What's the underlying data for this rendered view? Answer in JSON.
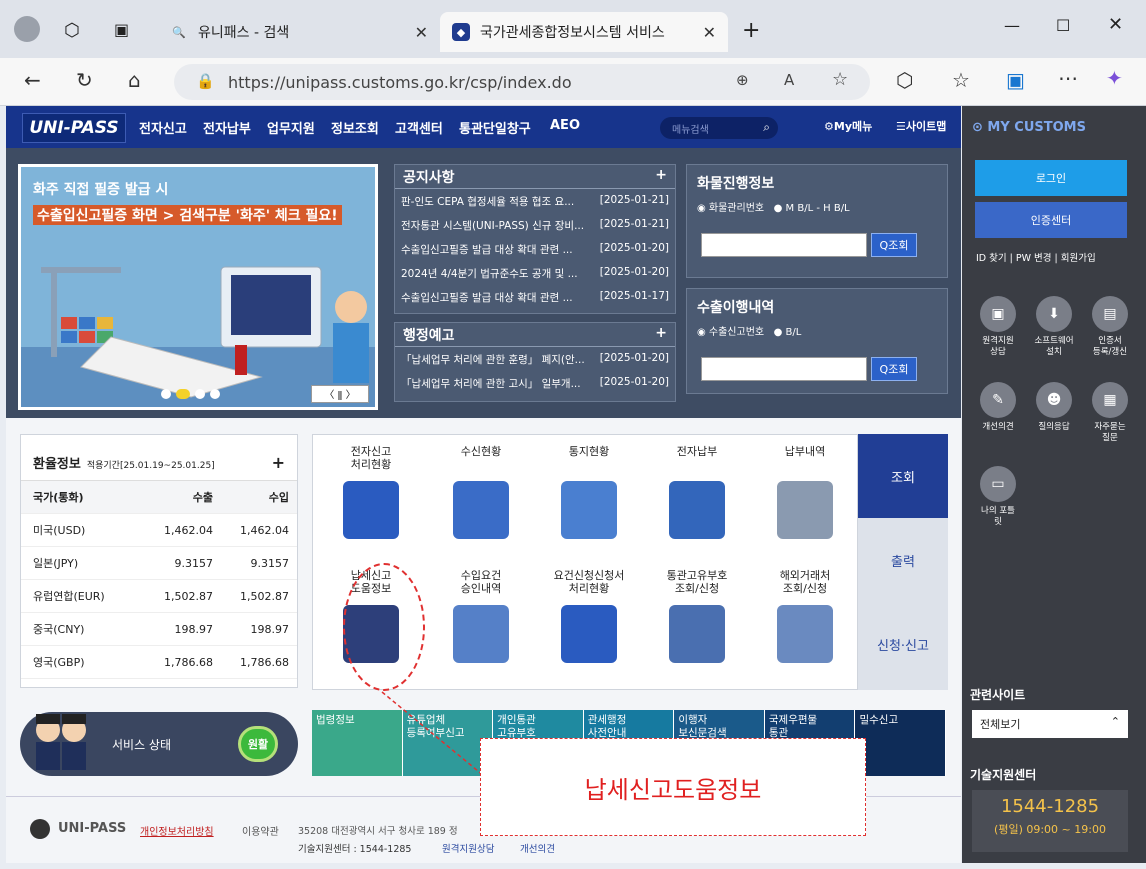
{
  "browser": {
    "tab_inactive": "유니패스 - 검색",
    "tab_active": "국가관세종합정보시스템 서비스",
    "url": "https://unipass.customs.go.kr/csp/index.do"
  },
  "gnb": {
    "logo": "UNI-PASS",
    "menus": [
      "전자신고",
      "전자납부",
      "업무지원",
      "정보조회",
      "고객센터",
      "통관단일창구",
      "AEO"
    ],
    "search_placeholder": "메뉴검색",
    "my_menu": "My메뉴",
    "sitemap": "사이트맵"
  },
  "banner": {
    "line1": "화주 직접 필증 발급 시",
    "line2": "수출입신고필증 화면 > 검색구분 '화주' 체크 필요!",
    "pager": "〈 ǁ 〉"
  },
  "notice": {
    "title": "공지사항",
    "plus": "+",
    "items": [
      {
        "t": "판-인도 CEPA 협정세율 적용 협조 요...",
        "d": "[2025-01-21]"
      },
      {
        "t": "전자통관 시스템(UNI-PASS) 신규 장비...",
        "d": "[2025-01-21]"
      },
      {
        "t": "수출입신고필증 발급 대상 확대 관련 ...",
        "d": "[2025-01-20]"
      },
      {
        "t": "2024년 4/4분기 법규준수도 공개 및 ...",
        "d": "[2025-01-20]"
      },
      {
        "t": "수출입신고필증 발급 대상 확대 관련 ...",
        "d": "[2025-01-17]"
      }
    ]
  },
  "admin": {
    "title": "행정예고",
    "plus": "+",
    "items": [
      {
        "t": "「납세업무 처리에 관한 훈령」 폐지(안...",
        "d": "[2025-01-20]"
      },
      {
        "t": "「납세업무 처리에 관한 고시」 일부개...",
        "d": "[2025-01-20]"
      }
    ]
  },
  "cargo": {
    "title": "화물진행정보",
    "radio1": "◉ 화물관리번호",
    "radio2": "● M B/L - H B/L",
    "btn": "Q조회"
  },
  "export": {
    "title": "수출이행내역",
    "radio1": "◉ 수출신고번호",
    "radio2": "● B/L",
    "btn": "Q조회"
  },
  "exchange": {
    "title": "환율정보",
    "period": "적용기간[25.01.19~25.01.25]",
    "plus": "+",
    "headers": [
      "국가(통화)",
      "수출",
      "수입"
    ],
    "rows": [
      [
        "미국(USD)",
        "1,462.04",
        "1,462.04"
      ],
      [
        "일본(JPY)",
        "9.3157",
        "9.3157"
      ],
      [
        "유럽연합(EUR)",
        "1,502.87",
        "1,502.87"
      ],
      [
        "중국(CNY)",
        "198.97",
        "198.97"
      ],
      [
        "영국(GBP)",
        "1,786.68",
        "1,786.68"
      ]
    ]
  },
  "services": [
    {
      "label": "전자신고\n처리현황",
      "color": "#2a5bc0"
    },
    {
      "label": "수신현황",
      "color": "#3a6cc7"
    },
    {
      "label": "통지현황",
      "color": "#4a7fd0"
    },
    {
      "label": "전자납부",
      "color": "#3366bb"
    },
    {
      "label": "납부내역",
      "color": "#8a9ab0"
    },
    {
      "label": "납세신고\n도움정보",
      "color": "#2d3f7a"
    },
    {
      "label": "수입요건\n승인내역",
      "color": "#5580c8"
    },
    {
      "label": "요건신청신청서\n처리현황",
      "color": "#2a5bc0"
    },
    {
      "label": "통관고유부호\n조회/신청",
      "color": "#4a6fb0"
    },
    {
      "label": "해외거래처\n조회/신청",
      "color": "#6a8ac0"
    }
  ],
  "service_tabs": [
    "조회",
    "출력",
    "신청·신고"
  ],
  "status": {
    "label": "서비스 상태",
    "badge": "원활"
  },
  "quick": [
    {
      "label": "법령정보",
      "color": "#3aa88a"
    },
    {
      "label": "유튜업체\n등록여부신고",
      "color": "#2f9a9a"
    },
    {
      "label": "개인통관\n고유부호",
      "color": "#1f8aa0"
    },
    {
      "label": "관세행정\n사전안내",
      "color": "#167aa0"
    },
    {
      "label": "이행자\n보신문검색",
      "color": "#1a5a8a"
    },
    {
      "label": "국제우편물\n통관",
      "color": "#123e70"
    },
    {
      "label": "밀수신고",
      "color": "#0e2c58"
    }
  ],
  "footer": {
    "logo": "UNI-PASS",
    "privacy": "개인정보처리방침",
    "terms": "이용약관",
    "address": "35208 대전광역시 서구 청사로 189 정",
    "support": "기술지원센터 : 1544-1285",
    "remote": "원격지원상담",
    "feedback": "개선의견"
  },
  "callout": "납세신고도움정보",
  "right": {
    "title": "MY CUSTOMS",
    "login": "로그인",
    "cert": "인증센터",
    "links": "ID 찾기 | PW 변경 | 회원가입",
    "icons": [
      {
        "label": "원격지원\n상담",
        "icon": "▣"
      },
      {
        "label": "소프트웨어\n설치",
        "icon": "⬇"
      },
      {
        "label": "인증서\n등록/갱신",
        "icon": "▤"
      },
      {
        "label": "개선의견",
        "icon": "✎"
      },
      {
        "label": "질의응답",
        "icon": "☻"
      },
      {
        "label": "자주묻는\n질문",
        "icon": "▦"
      },
      {
        "label": "나의 포틀\n릿",
        "icon": "▭"
      }
    ],
    "related": "관련사이트",
    "related_select": "전체보기",
    "tech": "기술지원센터",
    "phone": "1544-1285",
    "hours": "(평일) 09:00 ~ 19:00"
  }
}
